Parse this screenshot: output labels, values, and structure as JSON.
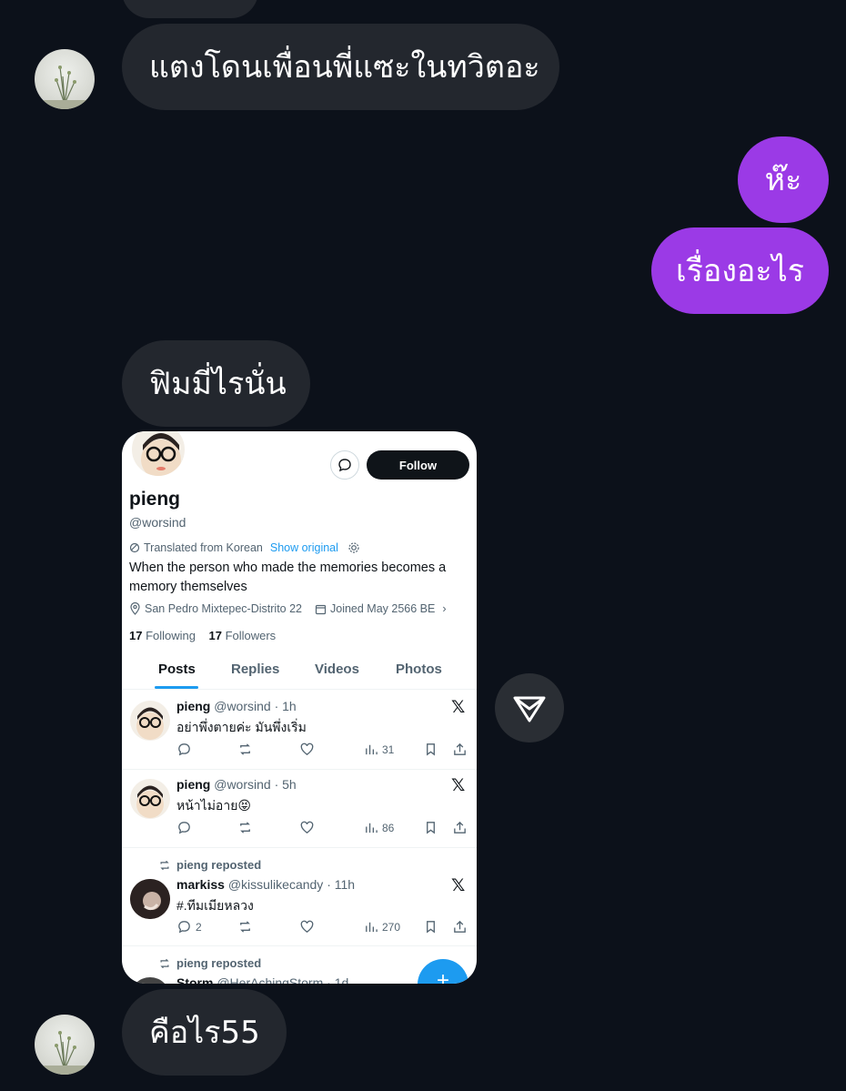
{
  "chat": {
    "messages": [
      {
        "from": "other",
        "text": "แตงโดนเพื่อนพี่แซะในทวิตอะ"
      },
      {
        "from": "me",
        "text": "ห๊ะ"
      },
      {
        "from": "me",
        "text": "เรื่องอะไร"
      },
      {
        "from": "other",
        "text": "ฟิมมี่ไรนั่น"
      },
      {
        "from": "other",
        "text": "คือไร55"
      }
    ]
  },
  "shared_screenshot": {
    "follow_label": "Follow",
    "name": "pieng",
    "handle": "@worsind",
    "translated_label": "Translated from Korean",
    "show_original": "Show original",
    "bio": "When the person who made the memories becomes a memory themselves",
    "location": "San Pedro Mixtepec-Distrito 22",
    "joined": "Joined May 2566 BE",
    "following_count": "17",
    "following_label": "Following",
    "followers_count": "17",
    "followers_label": "Followers",
    "tabs": [
      "Posts",
      "Replies",
      "Videos",
      "Photos"
    ],
    "posts": [
      {
        "name": "pieng",
        "meta": "@worsind · 1h",
        "text": "อย่าพึ่งตายค่ะ มันพึ่งเริ่ม",
        "replies": "",
        "views": "31"
      },
      {
        "name": "pieng",
        "meta": "@worsind · 5h",
        "text": "หน้าไม่อาย😝",
        "replies": "",
        "views": "86"
      },
      {
        "repost_label": "pieng reposted",
        "name": "markiss",
        "meta": "@kissulikecandy · 11h",
        "text": "#.ทีมเมียหลวง",
        "replies": "2",
        "views": "270"
      },
      {
        "repost_label": "pieng reposted",
        "name": "Storm",
        "meta": "@HerAchingStorm · 1d"
      }
    ],
    "fab_label": "+"
  },
  "icons": {
    "share": "send-icon",
    "x": "x-logo-icon"
  },
  "colors": {
    "background": "#0c111a",
    "received_bubble": "#23272e",
    "sent_bubble": "#9b3ae6",
    "twitter_blue": "#1d9bf0"
  }
}
